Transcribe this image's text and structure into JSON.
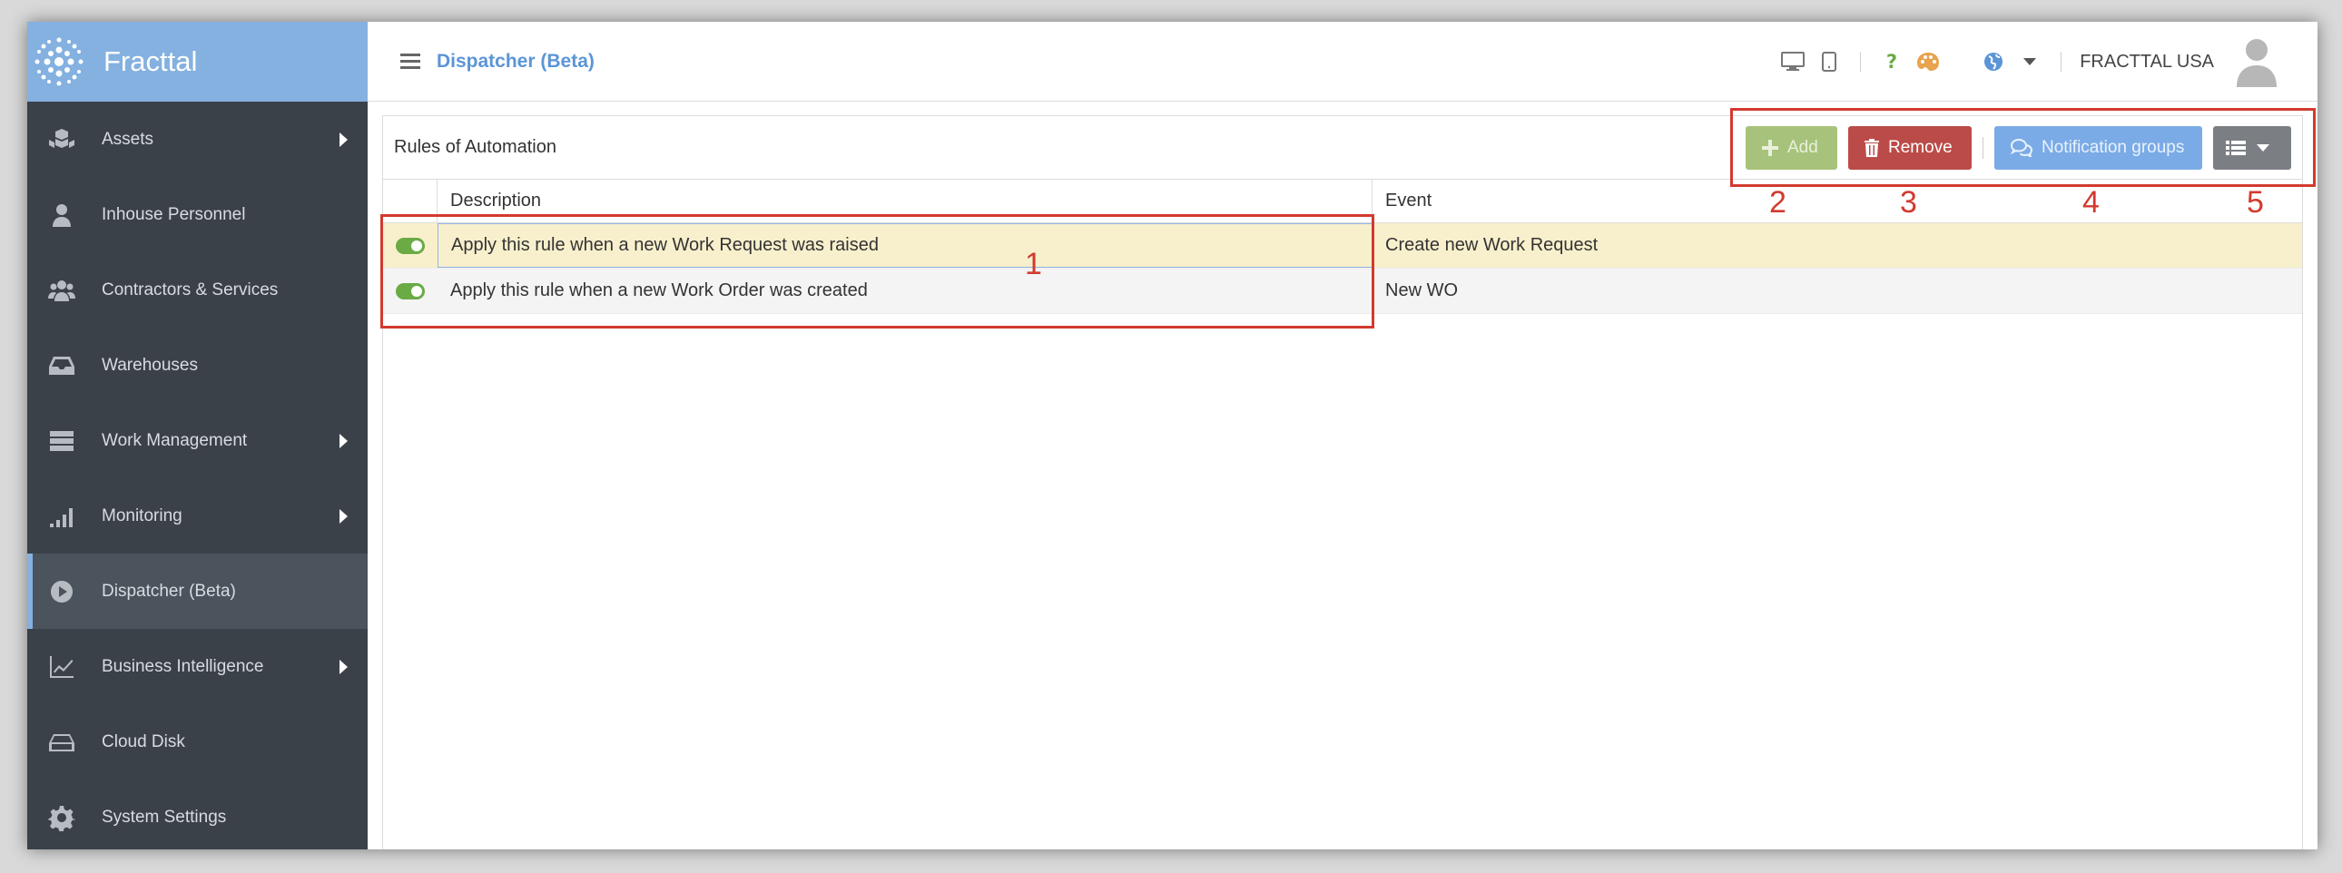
{
  "app": {
    "name": "Fracttal"
  },
  "sidebar": {
    "items": [
      {
        "label": "Assets",
        "icon": "cubes-icon",
        "has_submenu": true
      },
      {
        "label": "Inhouse Personnel",
        "icon": "person-icon",
        "has_submenu": false
      },
      {
        "label": "Contractors & Services",
        "icon": "users-icon",
        "has_submenu": false
      },
      {
        "label": "Warehouses",
        "icon": "inbox-icon",
        "has_submenu": false
      },
      {
        "label": "Work Management",
        "icon": "server-icon",
        "has_submenu": true
      },
      {
        "label": "Monitoring",
        "icon": "signal-icon",
        "has_submenu": true
      },
      {
        "label": "Dispatcher (Beta)",
        "icon": "play-circle-icon",
        "has_submenu": false,
        "active": true
      },
      {
        "label": "Business Intelligence",
        "icon": "line-chart-icon",
        "has_submenu": true
      },
      {
        "label": "Cloud Disk",
        "icon": "hdd-icon",
        "has_submenu": false
      },
      {
        "label": "System Settings",
        "icon": "gear-icon",
        "has_submenu": false
      }
    ]
  },
  "header": {
    "title": "Dispatcher (Beta)",
    "user": "FRACTTAL USA",
    "icons": [
      "desktop-icon",
      "tablet-icon",
      "help-icon",
      "palette-icon",
      "globe-icon",
      "caret-down-icon"
    ]
  },
  "panel": {
    "title": "Rules of Automation",
    "toolbar": {
      "add_label": "Add",
      "remove_label": "Remove",
      "notification_label": "Notification groups"
    },
    "columns": [
      "Description",
      "Event"
    ],
    "rows": [
      {
        "enabled": true,
        "description": "Apply this rule when a new Work Request was raised",
        "event": "Create new Work Request"
      },
      {
        "enabled": true,
        "description": "Apply this rule when a new Work Order was created",
        "event": "New WO"
      }
    ]
  },
  "annotations": [
    "1",
    "2",
    "3",
    "4",
    "5"
  ],
  "colors": {
    "sidebar_bg": "#3b4149",
    "brand_bg": "#84b1e0",
    "add": "#a7c27a",
    "remove": "#bb4b48",
    "notification": "#7aabe6",
    "annotation": "#d23a2f"
  }
}
